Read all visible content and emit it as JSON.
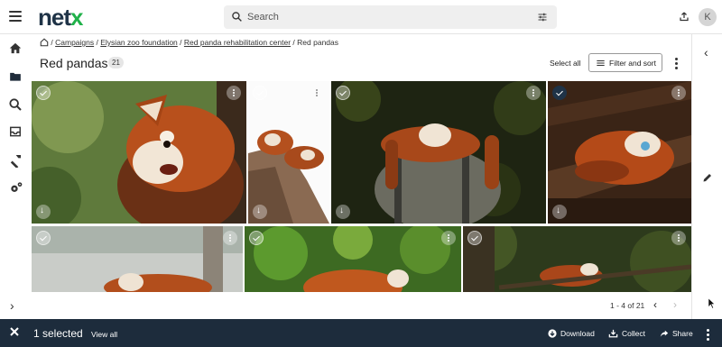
{
  "app": {
    "logo_main": "net",
    "logo_accent": "x",
    "logo_color": "#1f3347",
    "logo_accent_color": "#20b14a"
  },
  "header": {
    "search_placeholder": "Search",
    "user_initial": "K"
  },
  "sidebar": {
    "items": [
      "home-icon",
      "folder-icon",
      "search-icon",
      "inbox-icon",
      "hammer-icon",
      "settings-icon"
    ]
  },
  "breadcrumb": {
    "sep": "/",
    "items": [
      "Campaigns",
      "Elysian zoo foundation",
      "Red panda rehabilitation center"
    ],
    "current": "Red pandas"
  },
  "page": {
    "title": "Red pandas",
    "count": "21",
    "select_all": "Select all",
    "filter_sort": "Filter and sort"
  },
  "grid": {
    "tiles": [
      {
        "name": "red-panda-closeup",
        "selected": false
      },
      {
        "name": "two-red-pandas-tree",
        "selected": false
      },
      {
        "name": "red-panda-barrel",
        "selected": false
      },
      {
        "name": "red-panda-sleeping-log",
        "selected": true
      },
      {
        "name": "red-panda-fence",
        "selected": false
      },
      {
        "name": "red-panda-leaves",
        "selected": false
      },
      {
        "name": "red-panda-branch",
        "selected": false
      }
    ]
  },
  "pagination": {
    "range": "1 - 4 of 21"
  },
  "selection_bar": {
    "count_text": "1 selected",
    "view_all": "View all",
    "download": "Download",
    "collect": "Collect",
    "share": "Share"
  },
  "colors": {
    "selection_bar_bg": "#1d2c3c",
    "accent": "#20b14a"
  }
}
